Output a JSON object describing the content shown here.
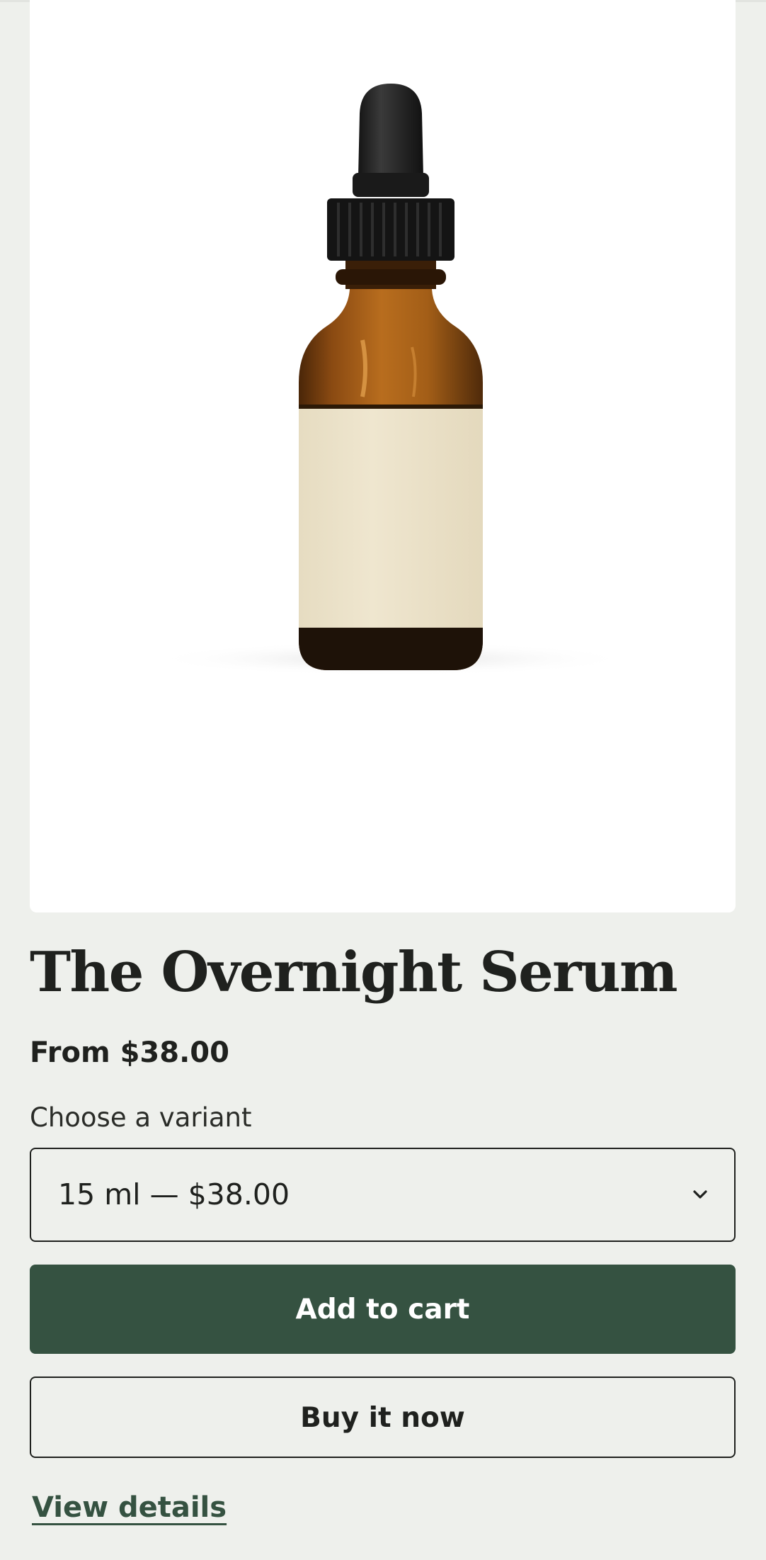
{
  "product": {
    "image_alt": "amber dropper bottle",
    "title": "The Overnight Serum",
    "price": "From $38.00"
  },
  "variant": {
    "label": "Choose a variant",
    "selected": "15 ml — $38.00",
    "icon": "chevron-down-icon"
  },
  "actions": {
    "add_to_cart": "Add to cart",
    "buy_now": "Buy it now",
    "view_details": "View details"
  },
  "colors": {
    "background": "#eef0ec",
    "primary_button": "#355241",
    "text": "#1f211e",
    "link": "#355241"
  }
}
